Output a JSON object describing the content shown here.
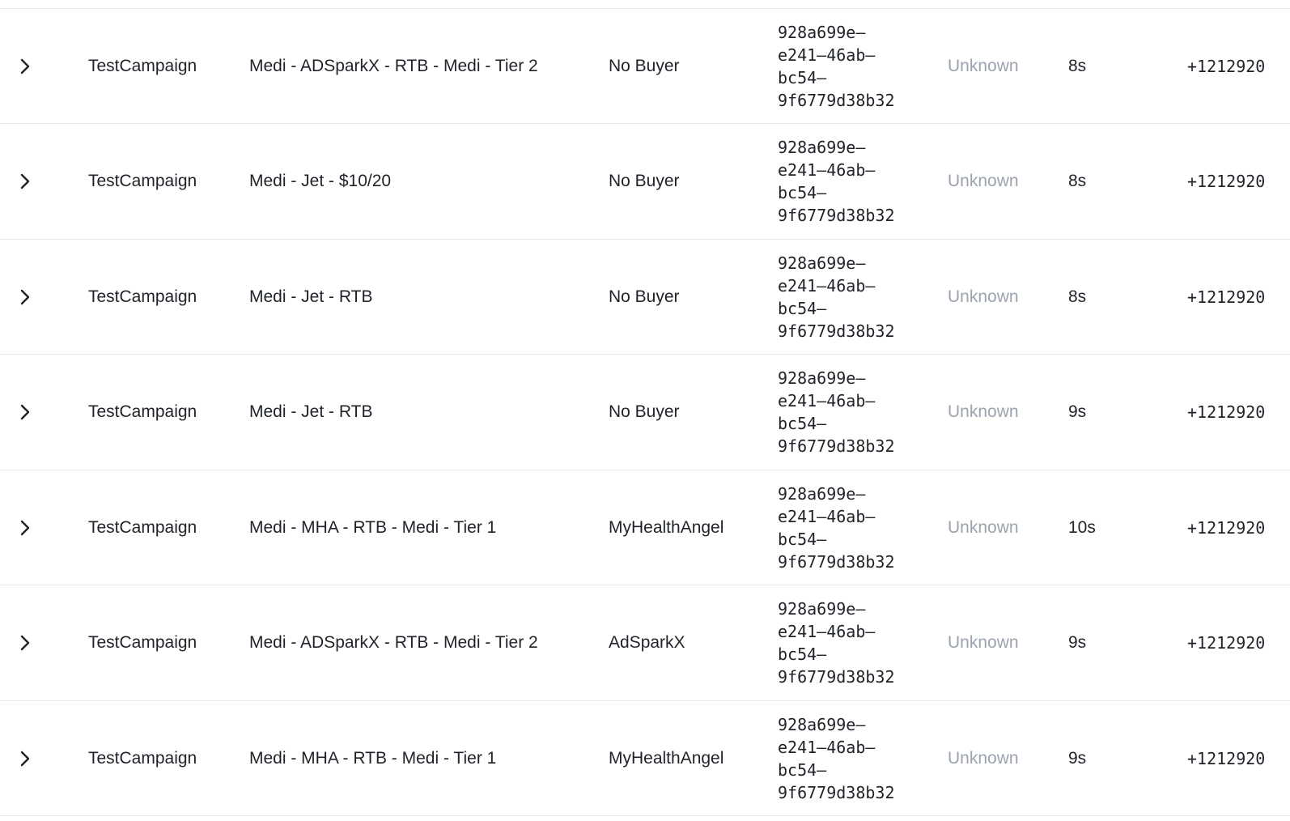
{
  "rows": [
    {
      "campaign": "TestCampaign",
      "target": "Medi - ADSparkX - RTB - Medi - Tier 2",
      "buyer": "No Buyer",
      "id_lines": [
        "928a699e–",
        "e241–46ab–",
        "bc54–",
        "9f6779d38b32"
      ],
      "status": "Unknown",
      "duration": "8s",
      "phone": "+1212920"
    },
    {
      "campaign": "TestCampaign",
      "target": "Medi - Jet - $10/20",
      "buyer": "No Buyer",
      "id_lines": [
        "928a699e–",
        "e241–46ab–",
        "bc54–",
        "9f6779d38b32"
      ],
      "status": "Unknown",
      "duration": "8s",
      "phone": "+1212920"
    },
    {
      "campaign": "TestCampaign",
      "target": "Medi - Jet - RTB",
      "buyer": "No Buyer",
      "id_lines": [
        "928a699e–",
        "e241–46ab–",
        "bc54–",
        "9f6779d38b32"
      ],
      "status": "Unknown",
      "duration": "8s",
      "phone": "+1212920"
    },
    {
      "campaign": "TestCampaign",
      "target": "Medi - Jet - RTB",
      "buyer": "No Buyer",
      "id_lines": [
        "928a699e–",
        "e241–46ab–",
        "bc54–",
        "9f6779d38b32"
      ],
      "status": "Unknown",
      "duration": "9s",
      "phone": "+1212920"
    },
    {
      "campaign": "TestCampaign",
      "target": "Medi - MHA - RTB - Medi - Tier 1",
      "buyer": "MyHealthAngel",
      "id_lines": [
        "928a699e–",
        "e241–46ab–",
        "bc54–",
        "9f6779d38b32"
      ],
      "status": "Unknown",
      "duration": "10s",
      "phone": "+1212920"
    },
    {
      "campaign": "TestCampaign",
      "target": "Medi - ADSparkX - RTB - Medi - Tier 2",
      "buyer": "AdSparkX",
      "id_lines": [
        "928a699e–",
        "e241–46ab–",
        "bc54–",
        "9f6779d38b32"
      ],
      "status": "Unknown",
      "duration": "9s",
      "phone": "+1212920"
    },
    {
      "campaign": "TestCampaign",
      "target": "Medi - MHA - RTB - Medi - Tier 1",
      "buyer": "MyHealthAngel",
      "id_lines": [
        "928a699e–",
        "e241–46ab–",
        "bc54–",
        "9f6779d38b32"
      ],
      "status": "Unknown",
      "duration": "9s",
      "phone": "+1212920"
    }
  ],
  "colors": {
    "text": "#1f2329",
    "muted_status": "#9ca3af",
    "divider": "#e5e7eb"
  },
  "icons": {
    "expand": "chevron-right-icon"
  }
}
